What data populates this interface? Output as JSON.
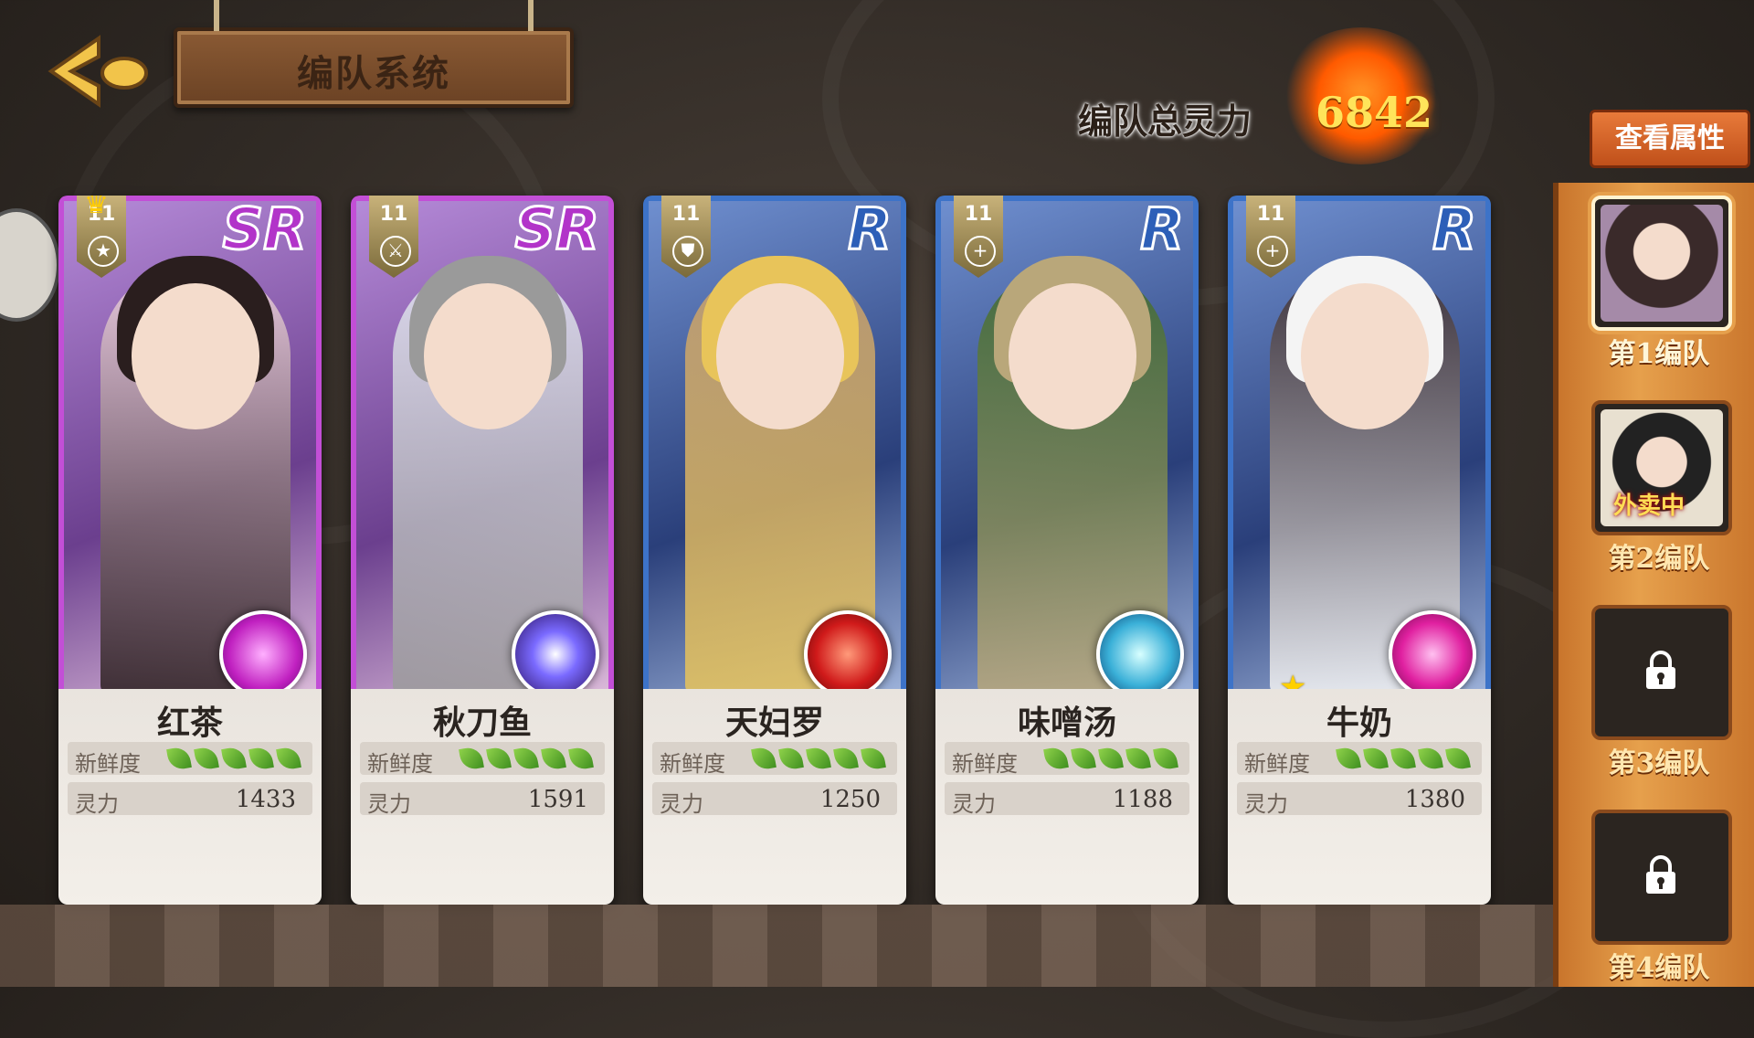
{
  "header": {
    "title": "编队系统",
    "total_power_label": "编队总灵力",
    "total_power_value": "6842",
    "view_attributes_label": "查看属性"
  },
  "cards": [
    {
      "name": "红茶",
      "rarity": "SR",
      "level": "11",
      "role_icon": "star-icon",
      "skill_icon": "pink-flower-orb-icon",
      "fresh_label": "新鲜度",
      "freshness": 5,
      "spirit_label": "灵力",
      "spirit": "1433",
      "crown": true,
      "star": false
    },
    {
      "name": "秋刀鱼",
      "rarity": "SR",
      "level": "11",
      "role_icon": "swords-icon",
      "skill_icon": "purple-burst-orb-icon",
      "fresh_label": "新鲜度",
      "freshness": 5,
      "spirit_label": "灵力",
      "spirit": "1591",
      "crown": false,
      "star": false
    },
    {
      "name": "天妇罗",
      "rarity": "R",
      "level": "11",
      "role_icon": "shield-icon",
      "skill_icon": "red-slash-orb-icon",
      "fresh_label": "新鲜度",
      "freshness": 5,
      "spirit_label": "灵力",
      "spirit": "1250",
      "crown": false,
      "star": false
    },
    {
      "name": "味噌汤",
      "rarity": "R",
      "level": "11",
      "role_icon": "plus-icon",
      "skill_icon": "blue-water-orb-icon",
      "fresh_label": "新鲜度",
      "freshness": 5,
      "spirit_label": "灵力",
      "spirit": "1188",
      "crown": false,
      "star": false
    },
    {
      "name": "牛奶",
      "rarity": "R",
      "level": "11",
      "role_icon": "plus-icon",
      "skill_icon": "magenta-heal-orb-icon",
      "fresh_label": "新鲜度",
      "freshness": 5,
      "spirit_label": "灵力",
      "spirit": "1380",
      "crown": false,
      "star": true
    }
  ],
  "teams": [
    {
      "label": "第1编队",
      "state": "active"
    },
    {
      "label": "第2编队",
      "state": "delivery",
      "status_text": "外卖中"
    },
    {
      "label": "第3编队",
      "state": "locked"
    },
    {
      "label": "第4编队",
      "state": "locked"
    }
  ],
  "colors": {
    "sr": "#c24fd6",
    "r": "#3d73c8",
    "accent": "#e87a3a",
    "power": "#ffe45a"
  }
}
